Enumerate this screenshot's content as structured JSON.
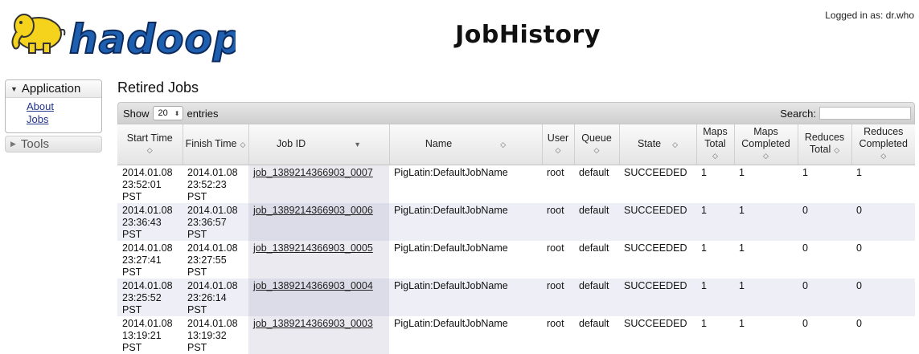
{
  "header": {
    "logo_text": "hadoop",
    "title": "JobHistory",
    "logged_in": "Logged in as: dr.who"
  },
  "nav": {
    "application_label": "Application",
    "links": [
      "About",
      "Jobs"
    ],
    "tools_label": "Tools"
  },
  "main": {
    "section_title": "Retired Jobs",
    "show_label": "Show",
    "entries_value": "20",
    "entries_label": "entries",
    "search_label": "Search:",
    "search_value": ""
  },
  "table": {
    "columns": [
      {
        "label": "Start Time"
      },
      {
        "label": "Finish Time"
      },
      {
        "label": "Job ID"
      },
      {
        "label": "Name"
      },
      {
        "label": "User"
      },
      {
        "label": "Queue"
      },
      {
        "label": "State"
      },
      {
        "label": "Maps Total"
      },
      {
        "label": "Maps Completed"
      },
      {
        "label": "Reduces Total"
      },
      {
        "label": "Reduces Completed"
      }
    ],
    "rows": [
      {
        "start": [
          "2014.01.08",
          "23:52:01",
          "PST"
        ],
        "finish": [
          "2014.01.08",
          "23:52:23",
          "PST"
        ],
        "job_id": "job_1389214366903_0007",
        "name": "PigLatin:DefaultJobName",
        "user": "root",
        "queue": "default",
        "state": "SUCCEEDED",
        "maps_total": "1",
        "maps_completed": "1",
        "reduces_total": "1",
        "reduces_completed": "1"
      },
      {
        "start": [
          "2014.01.08",
          "23:36:43",
          "PST"
        ],
        "finish": [
          "2014.01.08",
          "23:36:57",
          "PST"
        ],
        "job_id": "job_1389214366903_0006",
        "name": "PigLatin:DefaultJobName",
        "user": "root",
        "queue": "default",
        "state": "SUCCEEDED",
        "maps_total": "1",
        "maps_completed": "1",
        "reduces_total": "0",
        "reduces_completed": "0"
      },
      {
        "start": [
          "2014.01.08",
          "23:27:41",
          "PST"
        ],
        "finish": [
          "2014.01.08",
          "23:27:55",
          "PST"
        ],
        "job_id": "job_1389214366903_0005",
        "name": "PigLatin:DefaultJobName",
        "user": "root",
        "queue": "default",
        "state": "SUCCEEDED",
        "maps_total": "1",
        "maps_completed": "1",
        "reduces_total": "0",
        "reduces_completed": "0"
      },
      {
        "start": [
          "2014.01.08",
          "23:25:52",
          "PST"
        ],
        "finish": [
          "2014.01.08",
          "23:26:14",
          "PST"
        ],
        "job_id": "job_1389214366903_0004",
        "name": "PigLatin:DefaultJobName",
        "user": "root",
        "queue": "default",
        "state": "SUCCEEDED",
        "maps_total": "1",
        "maps_completed": "1",
        "reduces_total": "0",
        "reduces_completed": "0"
      },
      {
        "start": [
          "2014.01.08",
          "13:19:21",
          "PST"
        ],
        "finish": [
          "2014.01.08",
          "13:19:32",
          "PST"
        ],
        "job_id": "job_1389214366903_0003",
        "name": "PigLatin:DefaultJobName",
        "user": "root",
        "queue": "default",
        "state": "SUCCEEDED",
        "maps_total": "1",
        "maps_completed": "1",
        "reduces_total": "0",
        "reduces_completed": "0"
      }
    ]
  },
  "colors": {
    "logo_blue": "#1f5fb0",
    "logo_yellow": "#f5d21c",
    "link": "#22338a",
    "row_alt": "#eeeef7"
  }
}
